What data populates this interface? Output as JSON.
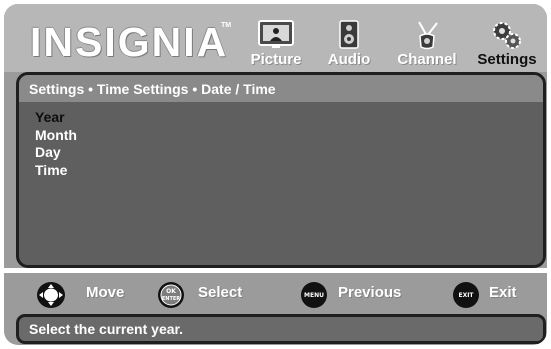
{
  "header": {
    "brand": "INSIGNIA",
    "trademark": "TM",
    "tabs": [
      {
        "label": "Picture",
        "icon": "tv-picture-icon",
        "active": false
      },
      {
        "label": "Audio",
        "icon": "speaker-icon",
        "active": false
      },
      {
        "label": "Channel",
        "icon": "antenna-icon",
        "active": false
      },
      {
        "label": "Settings",
        "icon": "gears-icon",
        "active": true
      }
    ]
  },
  "panel": {
    "breadcrumb": "Settings • Time Settings  • Date / Time",
    "items": [
      "Year",
      "Month",
      "Day",
      "Time"
    ],
    "selected_index": 0
  },
  "nav": {
    "move": {
      "label": "Move",
      "icon": "dpad-icon"
    },
    "select": {
      "label": "Select",
      "icon": "ok-enter-button-icon",
      "button_text": "OK\nENTER"
    },
    "previous": {
      "label": "Previous",
      "icon": "menu-button-icon",
      "button_text": "MENU"
    },
    "exit": {
      "label": "Exit",
      "icon": "exit-button-icon",
      "button_text": "EXIT"
    }
  },
  "status": {
    "text": "Select the current year."
  },
  "colors": {
    "frame": "#9b9b9b",
    "panel": "#5f5f5f",
    "highlight_text": "#0d0d0d"
  }
}
